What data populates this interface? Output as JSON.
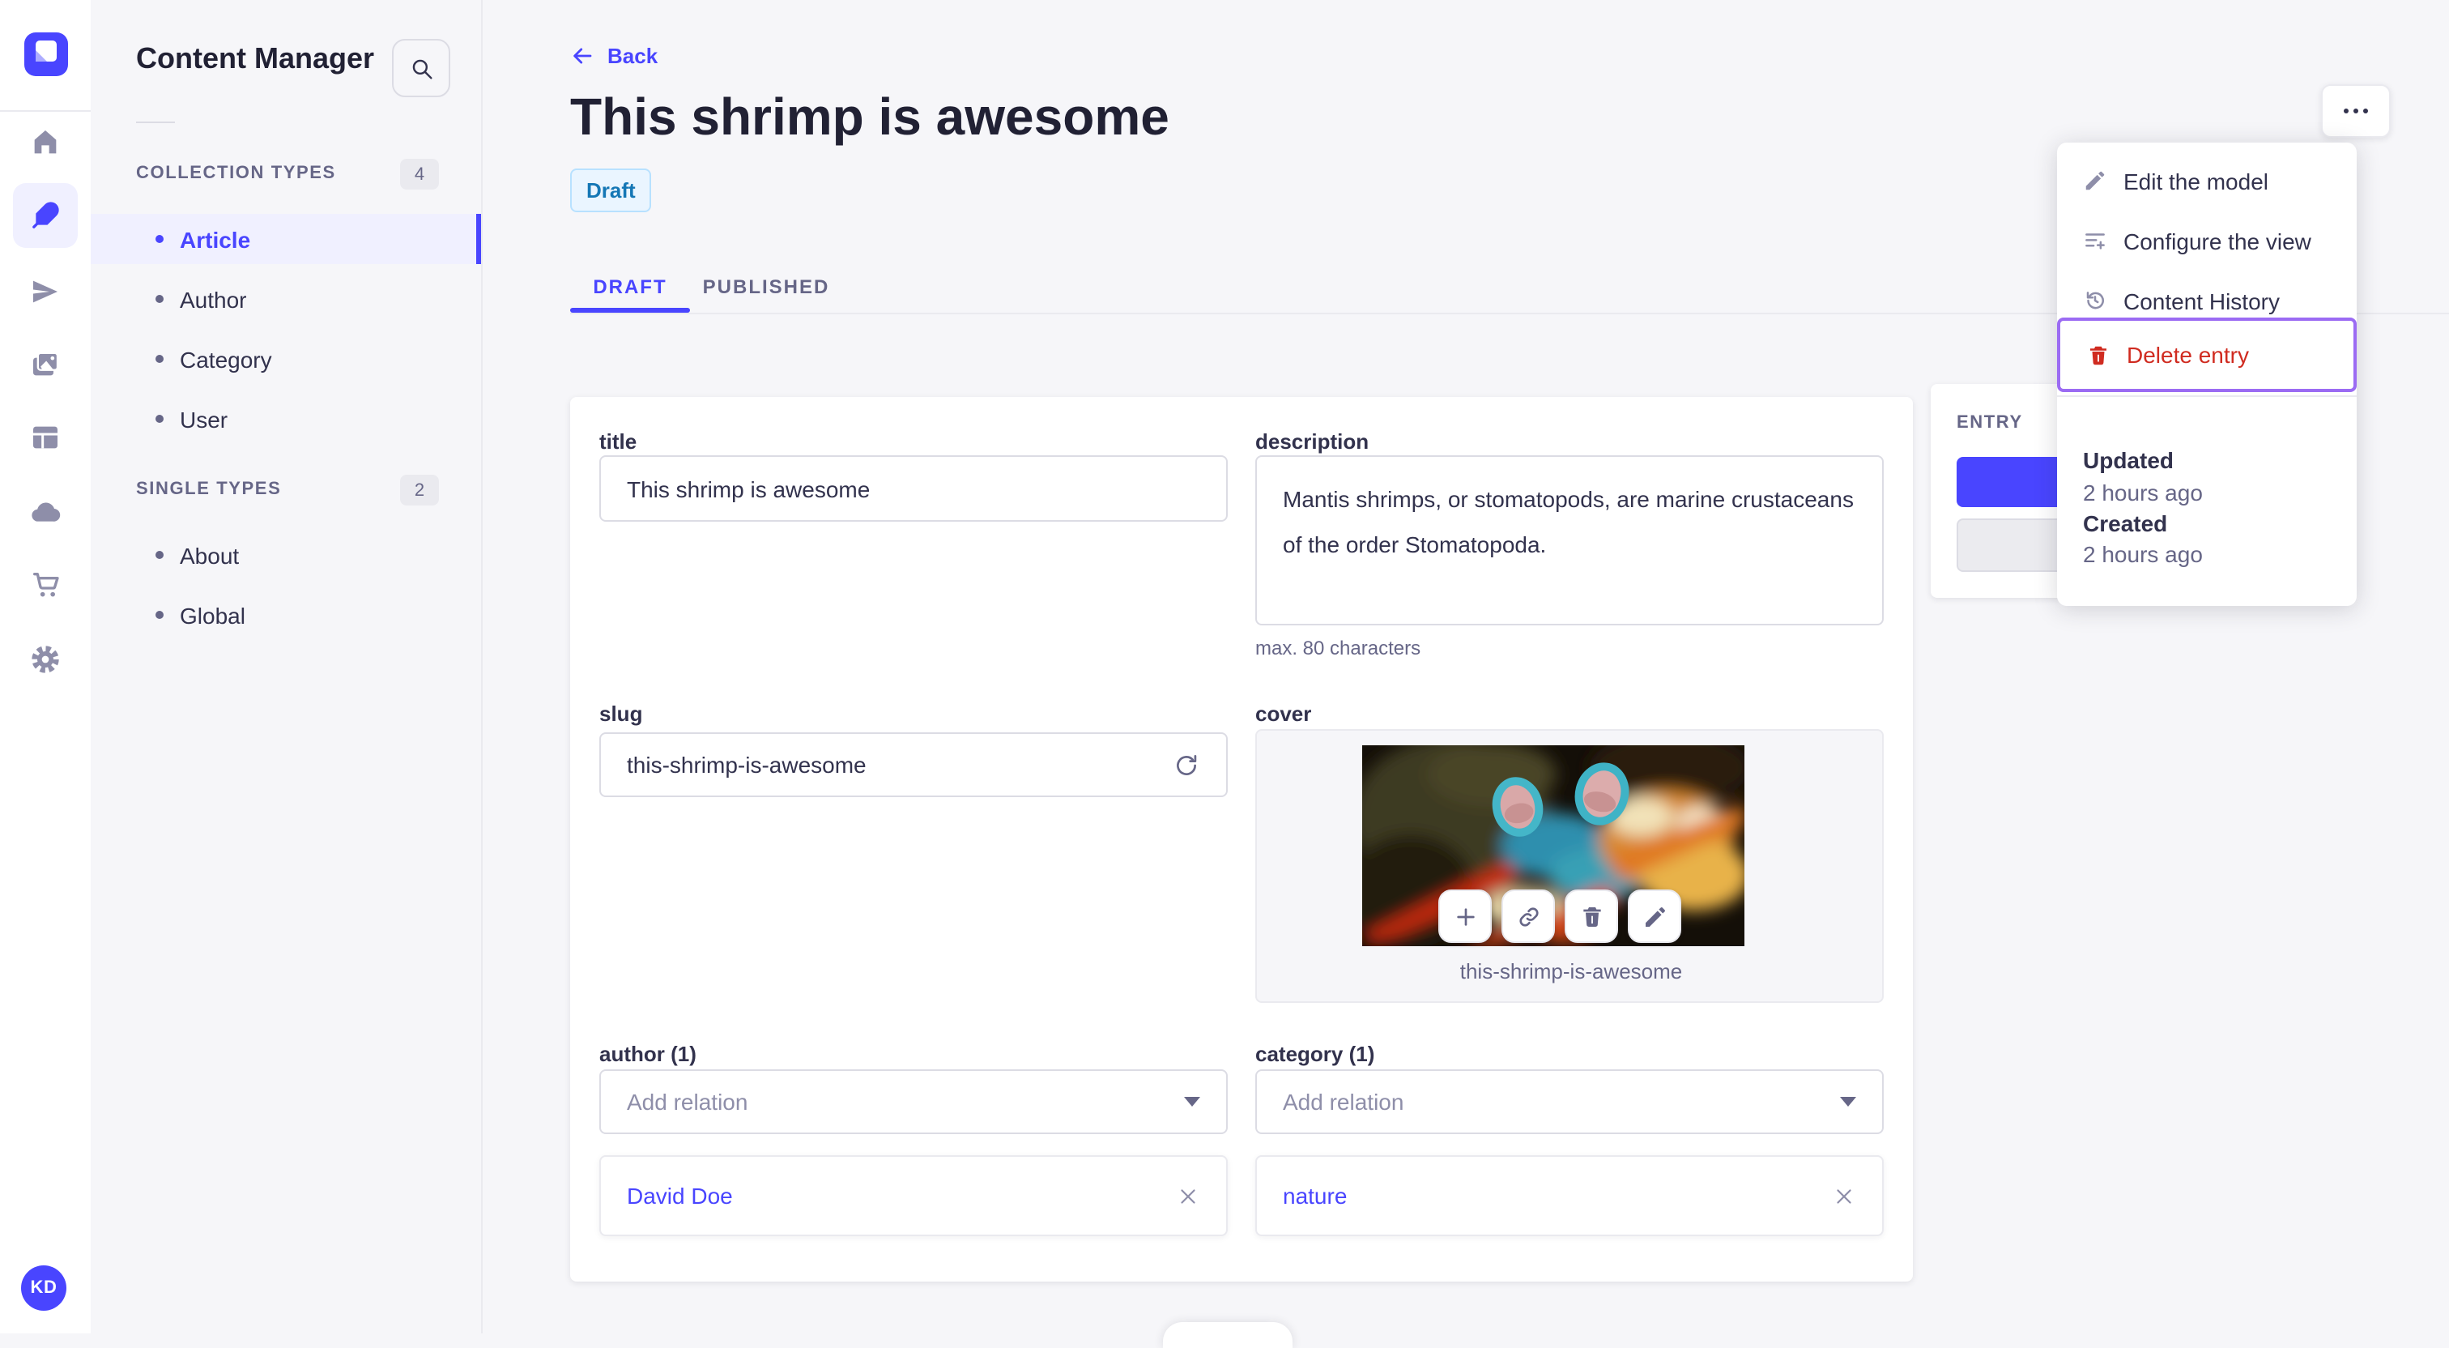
{
  "colors": {
    "accent": "#4945ff",
    "accent_bg": "#f0f0ff",
    "danger": "#d02b20",
    "menu_highlight": "#9b6bf3",
    "draft_bg": "#eaf5ff",
    "draft_border": "#b8e1ff",
    "draft_text": "#1577b5"
  },
  "nav": {
    "logo_icon": "strapi-logo",
    "icons": [
      "home-icon",
      "feather-icon",
      "send-icon",
      "media-icon",
      "layout-icon",
      "cloud-icon",
      "cart-icon",
      "gear-icon"
    ],
    "active_icon": "feather-icon",
    "avatar_initials": "KD"
  },
  "sidebar": {
    "title": "Content Manager",
    "search_icon": "search-icon",
    "sections": [
      {
        "label": "COLLECTION TYPES",
        "count": "4",
        "items": [
          {
            "label": "Article",
            "active": true
          },
          {
            "label": "Author",
            "active": false
          },
          {
            "label": "Category",
            "active": false
          },
          {
            "label": "User",
            "active": false
          }
        ]
      },
      {
        "label": "SINGLE TYPES",
        "count": "2",
        "items": [
          {
            "label": "About",
            "active": false
          },
          {
            "label": "Global",
            "active": false
          }
        ]
      }
    ]
  },
  "header": {
    "back_label": "Back",
    "title": "This shrimp is awesome",
    "status": "Draft",
    "tabs": [
      {
        "label": "DRAFT",
        "active": true
      },
      {
        "label": "PUBLISHED",
        "active": false
      }
    ]
  },
  "form": {
    "title": {
      "label": "title",
      "value": "This shrimp is awesome"
    },
    "description": {
      "label": "description",
      "value": "Mantis shrimps, or stomatopods, are marine crustaceans of the order Stomatopoda.",
      "hint": "max. 80 characters"
    },
    "slug": {
      "label": "slug",
      "value": "this-shrimp-is-awesome"
    },
    "cover": {
      "label": "cover",
      "caption": "this-shrimp-is-awesome",
      "actions": [
        "plus-icon",
        "link-icon",
        "trash-icon",
        "pencil-icon"
      ]
    },
    "author": {
      "label": "author (1)",
      "placeholder": "Add relation",
      "relation": "David Doe"
    },
    "category": {
      "label": "category (1)",
      "placeholder": "Add relation",
      "relation": "nature"
    }
  },
  "entry_panel": {
    "label": "ENTRY"
  },
  "menu": {
    "items": [
      {
        "label": "Edit the model",
        "icon": "pencil-icon"
      },
      {
        "label": "Configure the view",
        "icon": "list-plus-icon"
      },
      {
        "label": "Content History",
        "icon": "history-icon"
      },
      {
        "label": "Delete entry",
        "icon": "trash-icon",
        "danger": true,
        "highlighted": true
      }
    ],
    "meta": [
      {
        "label": "Updated",
        "value": "2 hours ago"
      },
      {
        "label": "Created",
        "value": "2 hours ago"
      }
    ]
  }
}
